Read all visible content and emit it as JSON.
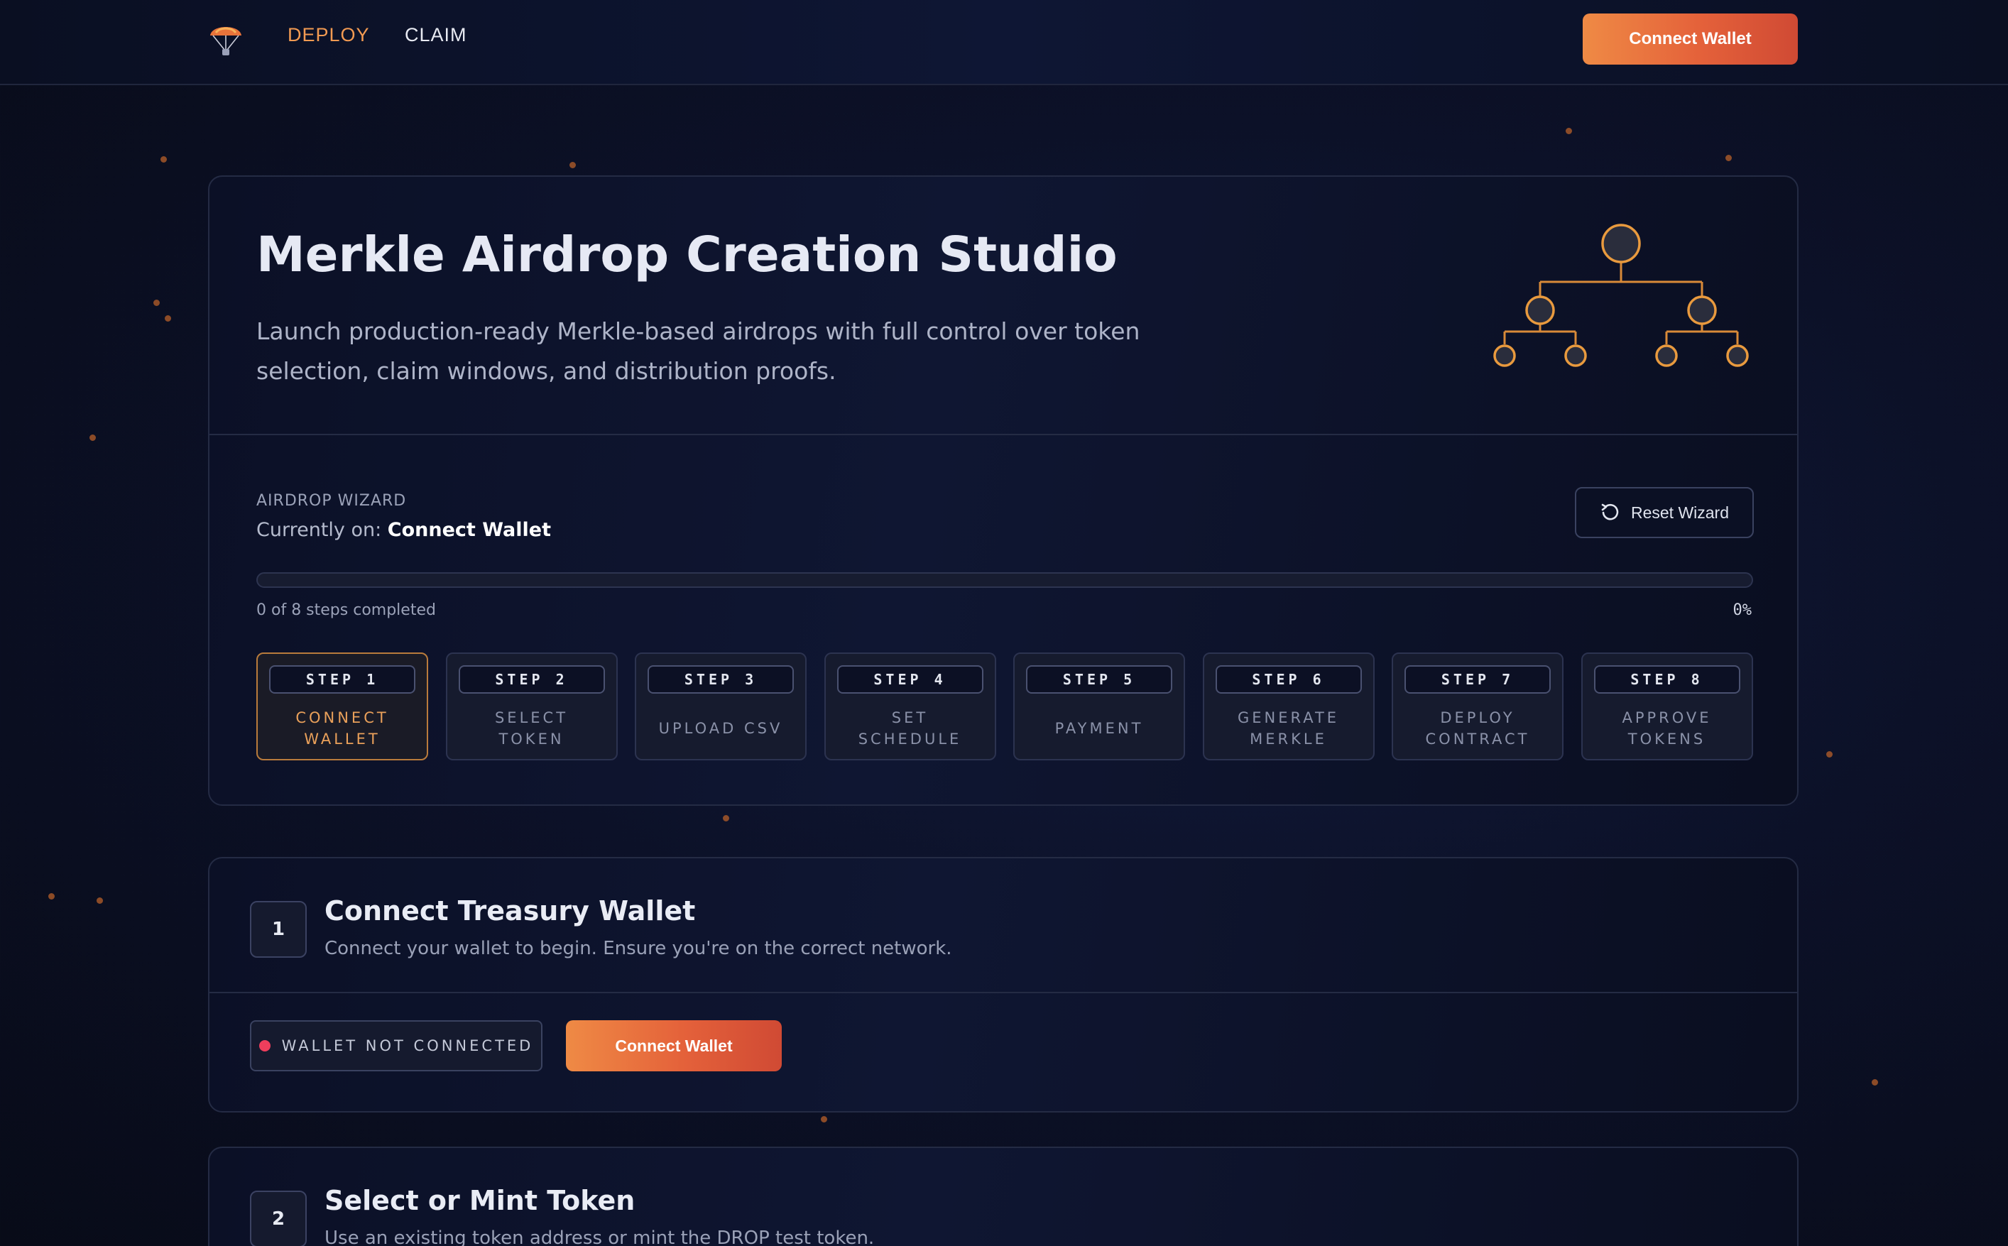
{
  "nav": {
    "links": [
      {
        "label": "DEPLOY",
        "active": true
      },
      {
        "label": "CLAIM",
        "active": false
      }
    ],
    "connect_label": "Connect Wallet"
  },
  "hero": {
    "title": "Merkle Airdrop Creation Studio",
    "description": "Launch production-ready Merkle-based airdrops with full control over token selection, claim windows, and distribution proofs."
  },
  "wizard": {
    "label": "AIRDROP WIZARD",
    "current_prefix": "Currently on:",
    "current_step": "Connect Wallet",
    "reset_label": "Reset Wizard",
    "progress_text": "0 of 8 steps completed",
    "progress_percent_label": "0%",
    "progress_value": 0,
    "steps": [
      {
        "badge": "STEP 1",
        "name": "Connect Wallet",
        "active": true
      },
      {
        "badge": "STEP 2",
        "name": "Select Token",
        "active": false
      },
      {
        "badge": "STEP 3",
        "name": "Upload CSV",
        "active": false
      },
      {
        "badge": "STEP 4",
        "name": "Set Schedule",
        "active": false
      },
      {
        "badge": "STEP 5",
        "name": "Payment",
        "active": false
      },
      {
        "badge": "STEP 6",
        "name": "Generate Merkle",
        "active": false
      },
      {
        "badge": "STEP 7",
        "name": "Deploy Contract",
        "active": false
      },
      {
        "badge": "STEP 8",
        "name": "Approve Tokens",
        "active": false
      }
    ]
  },
  "sections": [
    {
      "number": "1",
      "title": "Connect Treasury Wallet",
      "subtitle": "Connect your wallet to begin. Ensure you're on the correct network.",
      "status": "WALLET NOT CONNECTED",
      "cta": "Connect Wallet"
    },
    {
      "number": "2",
      "title": "Select or Mint Token",
      "subtitle": "Use an existing token address or mint the DROP test token."
    }
  ],
  "colors": {
    "accent": "#f0883f",
    "status_error": "#ef3e5c",
    "background": "#0c1128"
  },
  "icons": {
    "logo": "parachute-icon",
    "reset": "refresh-icon",
    "hero": "merkle-tree-icon"
  }
}
